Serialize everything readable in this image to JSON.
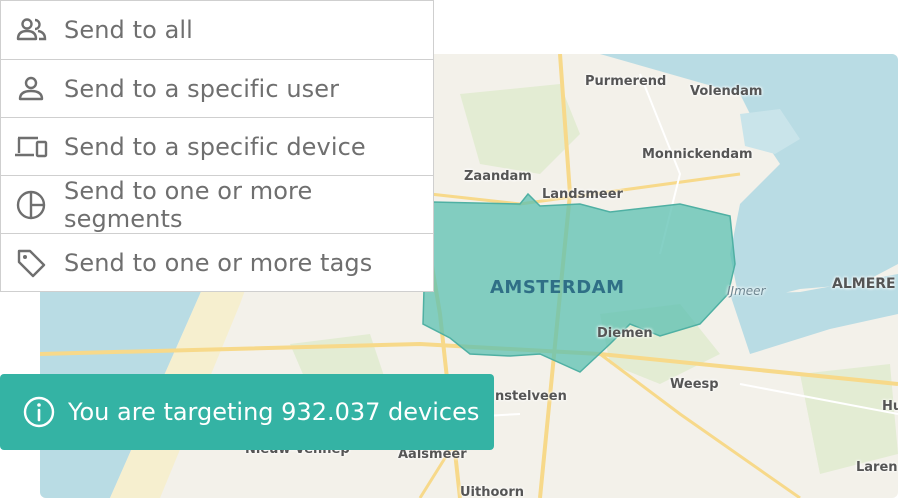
{
  "menu": {
    "items": [
      {
        "label": "Send to all",
        "icon": "people-icon"
      },
      {
        "label": "Send to a specific user",
        "icon": "person-icon"
      },
      {
        "label": "Send to a specific device",
        "icon": "devices-icon"
      },
      {
        "label": "Send to one or more segments",
        "icon": "pie-chart-icon"
      },
      {
        "label": "Send to one or more tags",
        "icon": "tag-icon"
      }
    ]
  },
  "toast": {
    "message": "You are targeting 932.037 devices",
    "icon": "info-icon",
    "color": "#34b3a4"
  },
  "map": {
    "highlight_color": "#5cc0b2",
    "water_color": "#b9dce4",
    "city": "AMSTERDAM",
    "places": {
      "purmerend": "Purmerend",
      "volendam": "Volendam",
      "monnickendam": "Monnickendam",
      "zaandam": "Zaandam",
      "landsmeer": "Landsmeer",
      "ijmeer": "IJmeer",
      "almere": "ALMERE",
      "diemen": "Diemen",
      "amstelveen": "nstelveen",
      "weesp": "Weesp",
      "nieuw_vennep": "Nieuw-Vennep",
      "aalsmeer": "Aalsmeer",
      "hu": "Hu",
      "laren": "Laren",
      "uithoorn": "Uithoorn"
    }
  }
}
